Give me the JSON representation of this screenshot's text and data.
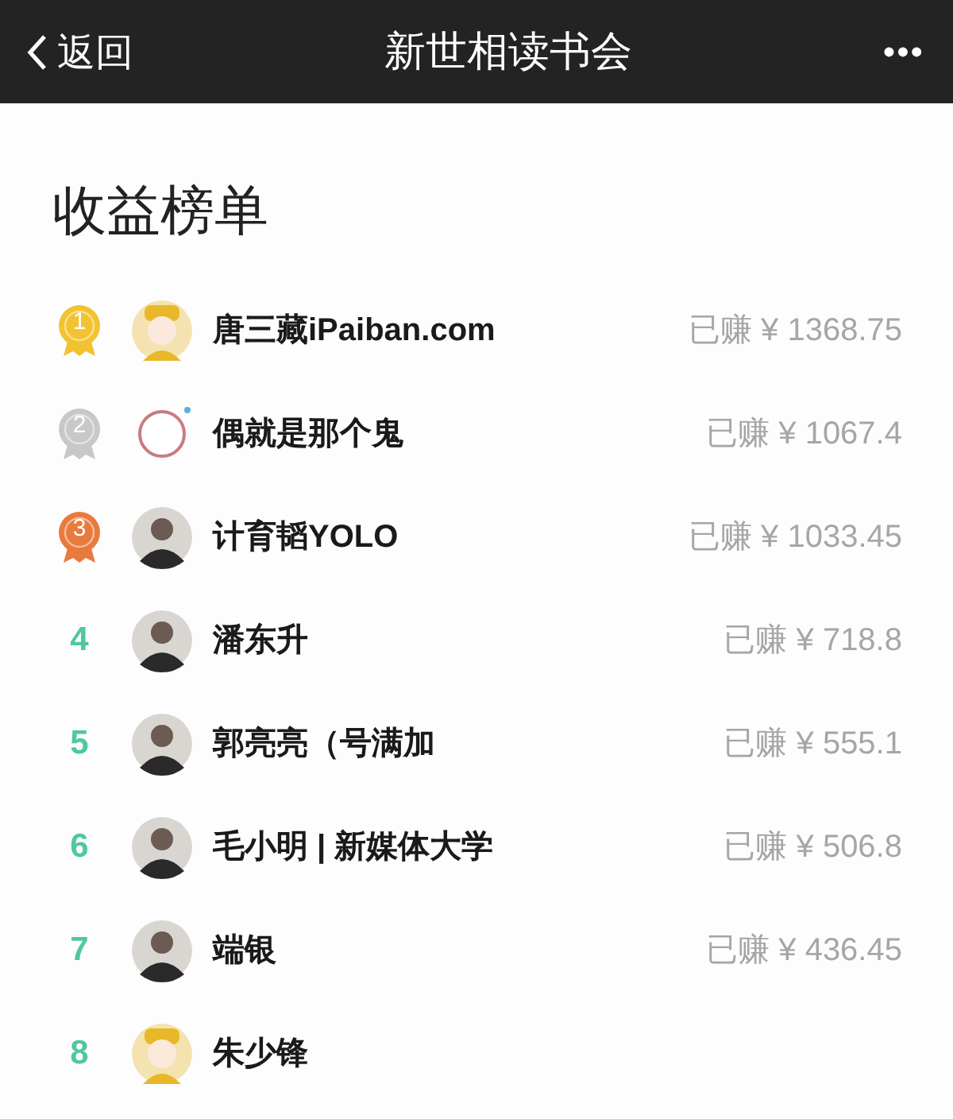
{
  "nav_bar": {
    "back_label": "返回",
    "title": "新世相读书会",
    "more": "•••"
  },
  "heading": "收益榜单",
  "rows": [
    {
      "rank": "1",
      "kind": "medal",
      "color": "#f2c230",
      "avatar": {
        "kind": "cartoon"
      },
      "name": "唐三藏iPaiban.com",
      "earned": "已赚 ¥ 1368.75"
    },
    {
      "rank": "2",
      "kind": "medal",
      "color": "#c8c8c8",
      "avatar": {
        "kind": "ring"
      },
      "name": "偶就是那个鬼",
      "earned": "已赚 ¥ 1067.4"
    },
    {
      "rank": "3",
      "kind": "medal",
      "color": "#e87a3e",
      "avatar": {
        "kind": "photo"
      },
      "name": "计育韬YOLO",
      "earned": "已赚 ¥ 1033.45"
    },
    {
      "rank": "4",
      "kind": "number",
      "avatar": {
        "kind": "photo"
      },
      "name": "潘东升",
      "earned": "已赚 ¥ 718.8"
    },
    {
      "rank": "5",
      "kind": "number",
      "avatar": {
        "kind": "photo"
      },
      "name": "郭亮亮（号满加",
      "earned": "已赚 ¥ 555.1"
    },
    {
      "rank": "6",
      "kind": "number",
      "avatar": {
        "kind": "photo"
      },
      "name": "毛小明 | 新媒体大学",
      "earned": "已赚 ¥ 506.8"
    },
    {
      "rank": "7",
      "kind": "number",
      "avatar": {
        "kind": "photo"
      },
      "name": "端银",
      "earned": "已赚 ¥ 436.45"
    },
    {
      "rank": "8",
      "kind": "number",
      "avatar": {
        "kind": "cartoon"
      },
      "name": "朱少锋"
    }
  ]
}
